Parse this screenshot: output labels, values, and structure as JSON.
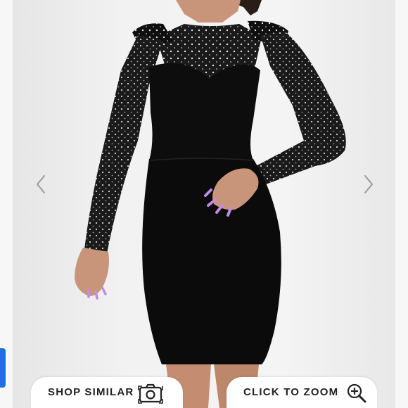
{
  "buttons": {
    "shop_similar": {
      "label": "SHOP SIMILAR",
      "icon": "camera-icon"
    },
    "click_to_zoom": {
      "label": "CLICK TO ZOOM",
      "icon": "zoom-in-icon"
    }
  },
  "carousel": {
    "prev_icon": "chevron-left-icon",
    "next_icon": "chevron-right-icon"
  },
  "colors": {
    "background": "#ececec",
    "dress": "#0d0d0d",
    "button_bg": "#ffffff",
    "button_text": "#222222",
    "arrow": "#9a9a9a",
    "accent_tab": "#1f6fe0",
    "nails": "#c28be8"
  }
}
